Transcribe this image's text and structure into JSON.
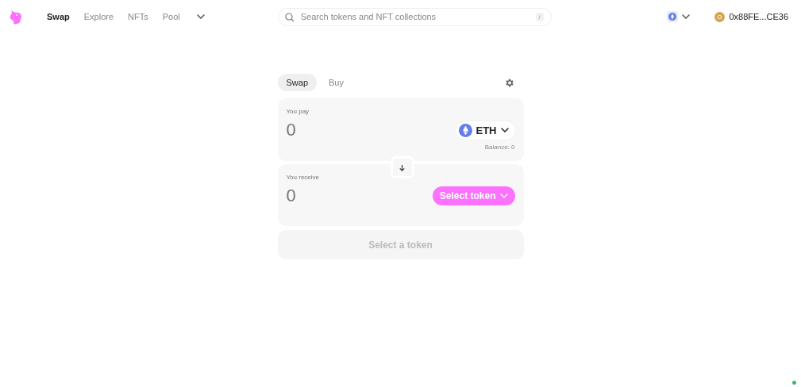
{
  "nav": {
    "items": [
      {
        "label": "Swap",
        "selected": true
      },
      {
        "label": "Explore",
        "selected": false
      },
      {
        "label": "NFTs",
        "selected": false
      },
      {
        "label": "Pool",
        "selected": false
      }
    ]
  },
  "search": {
    "placeholder": "Search tokens and NFT collections",
    "shortcut": "/"
  },
  "account": {
    "address": "0x88FE...CE36"
  },
  "swap": {
    "tabs": [
      {
        "label": "Swap",
        "selected": true
      },
      {
        "label": "Buy",
        "selected": false
      }
    ],
    "pay": {
      "label": "You pay",
      "placeholder": "0",
      "token": {
        "kind": "token",
        "label": "ETH"
      },
      "balance": "Balance: 0"
    },
    "receive": {
      "label": "You receive",
      "placeholder": "0",
      "token": {
        "kind": "select",
        "label": "Select token"
      }
    },
    "action": {
      "label": "Select a token",
      "disabled": true
    }
  }
}
